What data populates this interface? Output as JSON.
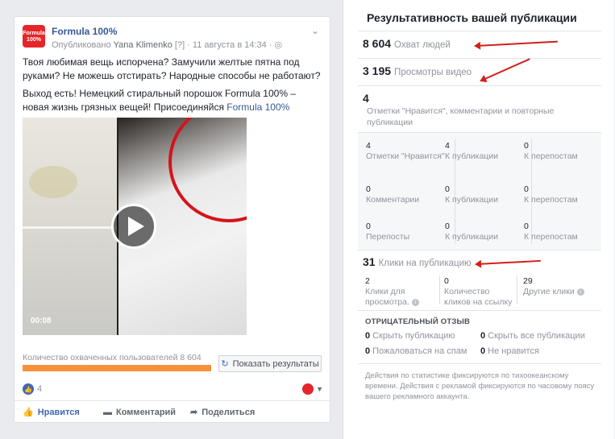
{
  "post": {
    "page_name": "Formula 100%",
    "logo_text": "Formula 100%",
    "published_prefix": "Опубликовано",
    "author": "Yana Klimenko",
    "help_mark": "[?]",
    "date": "11 августа в 14:34",
    "paragraph1": "Твоя любимая вещь испорчена? Замучили желтые пятна под руками? Не можешь отстирать? Народные способы не работают?",
    "paragraph2_text": "Выход есть! Немецкий стиральный порошок Formula 100% – новая жизнь грязных вещей! Присоединяйся ",
    "paragraph2_link": "Formula 100%",
    "video_duration": "00:08",
    "reach_label": "Количество охваченных пользователей 8 604",
    "reach_progress": 1.0,
    "show_results_button": "Показать результаты",
    "likes_count": "4",
    "actions": {
      "like": "Нравится",
      "comment": "Комментарий",
      "share": "Поделиться"
    },
    "colors": {
      "brand": "#e4262a",
      "link": "#365899",
      "progress": "#f7923a"
    }
  },
  "insights": {
    "title": "Результативность вашей публикации",
    "reach": {
      "value": "8 604",
      "label": "Охват людей"
    },
    "video_views": {
      "value": "3 195",
      "label": "Просмотры видео"
    },
    "engagement": {
      "value": "4",
      "label": "Отметки \"Нравится\", комментарии и повторные публикации"
    },
    "grid": [
      [
        {
          "n": "4",
          "l": "Отметки \"Нравится\""
        },
        {
          "n": "4",
          "l": "К публикации"
        },
        {
          "n": "0",
          "l": "К перепостам"
        }
      ],
      [
        {
          "n": "0",
          "l": "Комментарии"
        },
        {
          "n": "0",
          "l": "К публикации"
        },
        {
          "n": "0",
          "l": "К перепостам"
        }
      ],
      [
        {
          "n": "0",
          "l": "Перепосты"
        },
        {
          "n": "0",
          "l": "К публикации"
        },
        {
          "n": "0",
          "l": "К перепостам"
        }
      ]
    ],
    "clicks": {
      "value": "31",
      "label": "Клики на публикацию"
    },
    "click_details": [
      {
        "n": "2",
        "l": "Клики для просмотра."
      },
      {
        "n": "0",
        "l": "Количество кликов на ссылку"
      },
      {
        "n": "29",
        "l": "Другие клики"
      }
    ],
    "negative_title": "ОТРИЦАТЕЛЬНЫЙ ОТЗЫВ",
    "negative": [
      {
        "n": "0",
        "l": "Скрыть публикацию"
      },
      {
        "n": "0",
        "l": "Скрыть все публикации"
      },
      {
        "n": "0",
        "l": "Пожаловаться на спам"
      },
      {
        "n": "0",
        "l": "Не нравится"
      }
    ],
    "note": "Действия по статистике фиксируются по тихоокеанскому времени. Действия с рекламой фиксируются по часовому поясу вашего рекламного аккаунта."
  }
}
